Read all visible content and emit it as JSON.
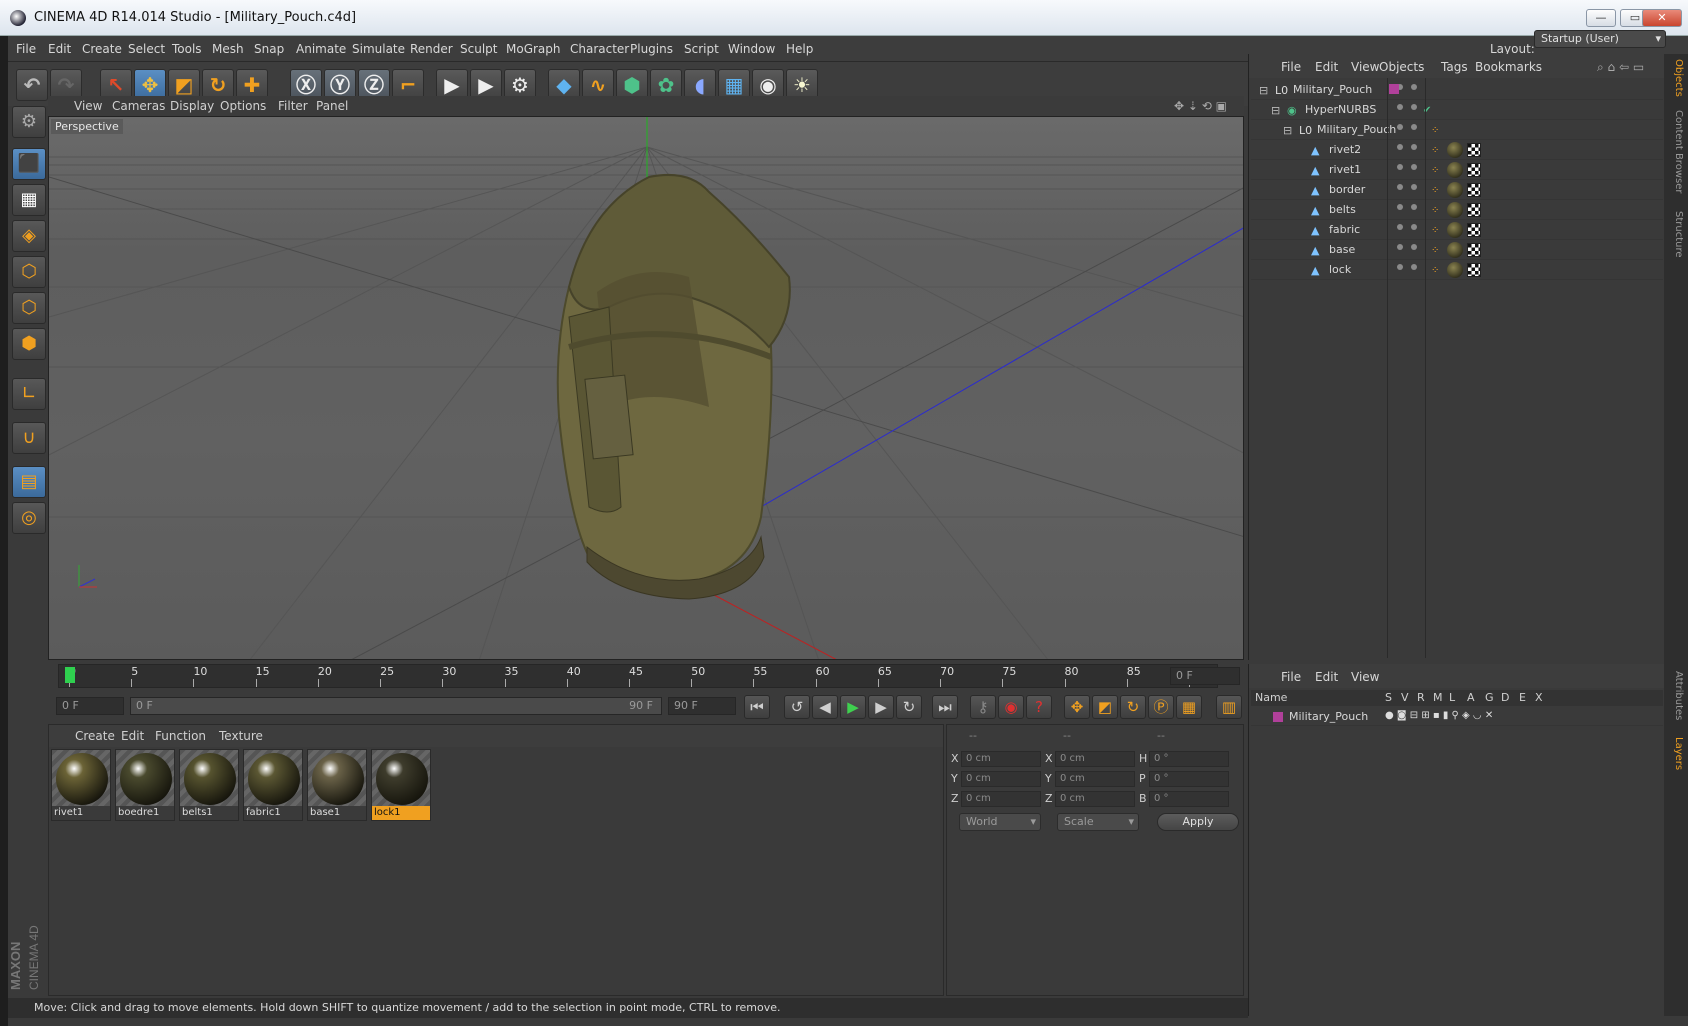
{
  "window": {
    "title": "CINEMA 4D R14.014 Studio - [Military_Pouch.c4d]",
    "min": "—",
    "max": "▭",
    "close": "✕"
  },
  "menu": [
    "File",
    "Edit",
    "Create",
    "Select",
    "Tools",
    "Mesh",
    "Snap",
    "Animate",
    "Simulate",
    "Render",
    "Sculpt",
    "MoGraph",
    "Character",
    "Plugins",
    "Script",
    "Window",
    "Help"
  ],
  "layout": {
    "label": "Layout:",
    "value": "Startup (User)"
  },
  "viewport": {
    "menu": [
      "View",
      "Cameras",
      "Display",
      "Options",
      "Filter",
      "Panel"
    ],
    "camera_label": "Perspective"
  },
  "timeline": {
    "ticks": [
      "0",
      "5",
      "10",
      "15",
      "20",
      "25",
      "30",
      "35",
      "40",
      "45",
      "50",
      "55",
      "60",
      "65",
      "70",
      "75",
      "80",
      "85",
      "90"
    ],
    "current_frame": "0 F"
  },
  "playback": {
    "start": "0 F",
    "range_start": "0 F",
    "range_end": "90 F",
    "end": "90 F"
  },
  "materials": {
    "menu": [
      "Create",
      "Edit",
      "Function",
      "Texture"
    ],
    "items": [
      {
        "label": "rivet1",
        "color": "#6b6336"
      },
      {
        "label": "boedre1",
        "color": "#4a4a2e"
      },
      {
        "label": "belts1",
        "color": "#56532f"
      },
      {
        "label": "fabric1",
        "color": "#5b5733"
      },
      {
        "label": "base1",
        "color": "#6a6248"
      },
      {
        "label": "lock1",
        "color": "#3e3c2c",
        "selected": true
      }
    ]
  },
  "coords": {
    "headers": [
      "--",
      "--",
      "--"
    ],
    "rows": [
      {
        "a": "X",
        "av": "0 cm",
        "b": "X",
        "bv": "0 cm",
        "c": "H",
        "cv": "0 °"
      },
      {
        "a": "Y",
        "av": "0 cm",
        "b": "Y",
        "bv": "0 cm",
        "c": "P",
        "cv": "0 °"
      },
      {
        "a": "Z",
        "av": "0 cm",
        "b": "Z",
        "bv": "0 cm",
        "c": "B",
        "cv": "0 °"
      }
    ],
    "space": "World",
    "mode": "Scale",
    "apply": "Apply"
  },
  "status": "Move: Click and drag to move elements. Hold down SHIFT to quantize movement / add to the selection in point mode, CTRL to remove.",
  "objects": {
    "menu": [
      "File",
      "Edit",
      "View",
      "Objects",
      "Tags",
      "Bookmarks"
    ],
    "items": [
      {
        "name": "Military_Pouch",
        "indent": 0,
        "type": "null"
      },
      {
        "name": "HyperNURBS",
        "indent": 1,
        "type": "nurbs"
      },
      {
        "name": "Military_Pouch",
        "indent": 2,
        "type": "null"
      },
      {
        "name": "rivet2",
        "indent": 3,
        "type": "mesh"
      },
      {
        "name": "rivet1",
        "indent": 3,
        "type": "mesh"
      },
      {
        "name": "border",
        "indent": 3,
        "type": "mesh"
      },
      {
        "name": "belts",
        "indent": 3,
        "type": "mesh"
      },
      {
        "name": "fabric",
        "indent": 3,
        "type": "mesh"
      },
      {
        "name": "base",
        "indent": 3,
        "type": "mesh"
      },
      {
        "name": "lock",
        "indent": 3,
        "type": "mesh"
      }
    ]
  },
  "layers": {
    "menu": [
      "File",
      "Edit",
      "View"
    ],
    "columns": [
      "Name",
      "S",
      "V",
      "R",
      "M",
      "L",
      "A",
      "G",
      "D",
      "E",
      "X"
    ],
    "items": [
      {
        "name": "Military_Pouch",
        "color": "#b0409a"
      }
    ]
  },
  "right_tabs": [
    "Objects",
    "Content Browser",
    "Structure",
    "Attributes",
    "Layers"
  ],
  "brand": [
    "MAXON",
    "CINEMA 4D"
  ]
}
